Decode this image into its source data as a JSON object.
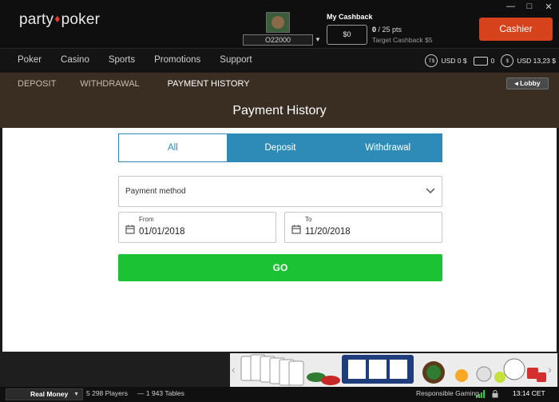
{
  "window": {
    "controls": [
      "—",
      "□",
      "✕"
    ]
  },
  "header": {
    "logo_part1": "party",
    "logo_accent": "♦",
    "logo_part2": "poker",
    "username": "O22000",
    "cashback_title": "My Cashback",
    "cashback_value": "$0",
    "pts_value": "0",
    "pts_total": "/ 25 pts",
    "target_cashback": "Target Cashback $5",
    "cashier_label": "Cashier"
  },
  "nav": {
    "items": [
      "Poker",
      "Casino",
      "Sports",
      "Promotions",
      "Support"
    ],
    "balances": [
      {
        "icon": "ts-icon",
        "glyph": "T$",
        "value": "USD 0 $"
      },
      {
        "icon": "ticket-icon",
        "glyph": "",
        "value": "0"
      },
      {
        "icon": "dollar-icon",
        "glyph": "$",
        "value": "USD 13,23 $"
      }
    ]
  },
  "subnav": {
    "tabs": [
      "DEPOSIT",
      "WITHDRAWAL",
      "PAYMENT HISTORY"
    ],
    "active_tab": "PAYMENT HISTORY",
    "lobby_label": "◂ Lobby"
  },
  "page": {
    "title": "Payment History",
    "segments": [
      "All",
      "Deposit",
      "Withdrawal"
    ],
    "selected_segment": "All",
    "payment_method_label": "Payment method",
    "from_label": "From",
    "from_value": "01/01/2018",
    "to_label": "To",
    "to_value": "11/20/2018",
    "go_label": "GO"
  },
  "statusbar": {
    "mode": "Real Money",
    "players": "5 298 Players",
    "tables": "— 1 943 Tables",
    "responsible_gaming": "Responsible Gaming",
    "time": "13:14 CET"
  },
  "colors": {
    "brand_red": "#e83b2a",
    "cashier_orange": "#d6421c",
    "segment_blue": "#2e8bb8",
    "go_green": "#1bc234",
    "subnav_brown": "#3a2e23"
  }
}
